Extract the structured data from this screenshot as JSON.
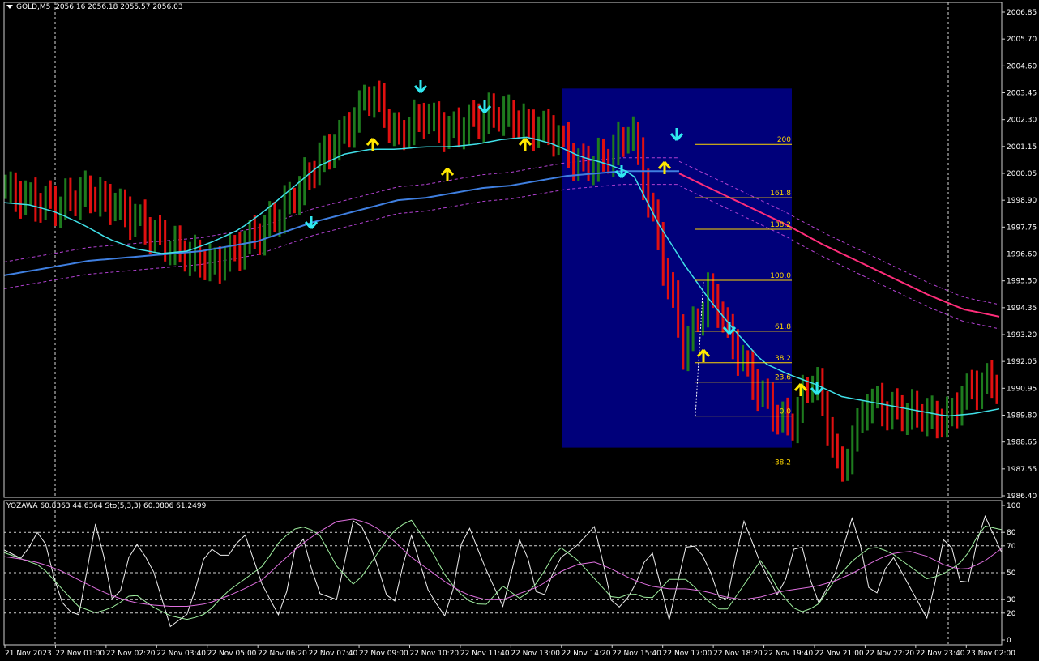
{
  "header": {
    "symbol": "GOLD,M5",
    "ohlc": "2056.16 2056.18 2055.57 2056.03"
  },
  "sub_header": {
    "text": "YOZAWA 60.8363 44.6364  Sto(5,3,3) 60.0806 61.2499"
  },
  "colors": {
    "background": "#000000",
    "bull": "#1e7b1e",
    "bear": "#e01010",
    "ma_fast": "#40e0e8",
    "ma_slow": "#3f7fe0",
    "ma_long": "#ff2d7a",
    "band": "#b040d0",
    "box": "#00007a",
    "fib": "#ffd700",
    "grid": "#9a9a9a",
    "arrow_up": "#ffe800",
    "arrow_down": "#30e8f0"
  },
  "chart_data": [
    {
      "type": "line",
      "ylim": [
        1986.45,
        2006.85
      ],
      "y_ticks": [
        "2006.85",
        "2005.70",
        "2004.60",
        "2003.45",
        "2002.30",
        "2001.15",
        "2000.05",
        "1998.90",
        "1997.75",
        "1996.60",
        "1995.50",
        "1994.35",
        "1993.20",
        "1992.05",
        "1990.95",
        "1989.80",
        "1988.65",
        "1987.55",
        "1986.40"
      ],
      "x_ticks": [
        "21 Nov 2023",
        "22 Nov 01:00",
        "22 Nov 02:20",
        "22 Nov 03:40",
        "22 Nov 05:00",
        "22 Nov 06:20",
        "22 Nov 07:40",
        "22 Nov 09:00",
        "22 Nov 10:20",
        "22 Nov 11:40",
        "22 Nov 13:00",
        "22 Nov 14:20",
        "22 Nov 15:40",
        "22 Nov 17:00",
        "22 Nov 18:20",
        "22 Nov 19:40",
        "22 Nov 21:00",
        "22 Nov 22:20",
        "22 Nov 23:40",
        "23 Nov 02:00"
      ],
      "x": [
        0,
        2,
        4,
        6,
        8,
        10,
        12,
        14,
        16,
        18,
        20,
        22,
        24,
        26,
        28,
        30,
        32,
        34,
        36,
        38
      ],
      "price": [
        1999.1,
        1998.7,
        1998.5,
        1999.0,
        1998.6,
        1997.9,
        1997.0,
        1996.4,
        1996.0,
        1996.8,
        1997.6,
        1998.8,
        2000.3,
        2001.5,
        2003.2,
        2001.3,
        2002.2,
        2001.5,
        2002.0,
        2002.3,
        2001.7,
        2001.5,
        2000.1,
        2000.4,
        2001.6,
        1997.1,
        1992.5,
        1995.0,
        1992.5,
        1990.6,
        1989.3,
        1991.5,
        1987.4,
        1990.4,
        1990.0,
        1989.9,
        1989.6,
        1991.0,
        1991.2
      ],
      "series": [
        {
          "values": [
            1998.6,
            1998.5,
            1998.2,
            1997.7,
            1997.1,
            1996.7,
            1996.5,
            1996.6,
            1997.0,
            1997.5,
            1998.3,
            1999.2,
            2000.1,
            2000.6,
            2000.8,
            2000.8,
            2000.9,
            2000.9,
            2001.0,
            2001.2,
            2001.3,
            2001.0,
            2000.5,
            2000.2,
            1999.8,
            1997.7,
            1996.0,
            1994.5,
            1993.2,
            1992.0,
            1991.5,
            1991.1,
            1990.6,
            1990.4,
            1990.2,
            1990.0,
            1989.8,
            1989.9,
            1990.1
          ]
        },
        {
          "values": [
            1995.6,
            1995.8,
            1996.0,
            1996.2,
            1996.3,
            1996.4,
            1996.5,
            1996.6,
            1996.8,
            1997.0,
            1997.4,
            1997.8,
            1998.1,
            1998.4,
            1998.7,
            1998.8,
            1999.0,
            1999.2,
            1999.3,
            1999.5,
            1999.7,
            1999.8,
            1999.9,
            1999.9,
            1999.9
          ]
        },
        {
          "values": [
            1999.8,
            1999.1,
            1998.4,
            1997.7,
            1996.9,
            1996.2,
            1995.5,
            1994.8,
            1994.2,
            1993.9
          ]
        }
      ]
    },
    {
      "type": "line",
      "ylim": [
        0,
        100
      ],
      "y_ticks": [
        "100",
        "80",
        "70",
        "50",
        "30",
        "20",
        "0"
      ],
      "levels": [
        80,
        70,
        50,
        30,
        20
      ],
      "series": [
        {
          "values": [
            67,
            60,
            85,
            30,
            15,
            90,
            20,
            75,
            55,
            10,
            20,
            70,
            60,
            80,
            40,
            15,
            85,
            35,
            30,
            95,
            65,
            20,
            80,
            35,
            15,
            90,
            55,
            25,
            80,
            25,
            60,
            70,
            85,
            20,
            35,
            70,
            15,
            75,
            60,
            20,
            90,
            55,
            30,
            80,
            25,
            50,
            95,
            25,
            65,
            40,
            15,
            85,
            30,
            95,
            65
          ]
        },
        {
          "values": [
            65,
            60,
            55,
            40,
            25,
            20,
            25,
            35,
            25,
            18,
            15,
            20,
            35,
            45,
            55,
            75,
            85,
            80,
            55,
            40,
            60,
            80,
            90,
            70,
            45,
            30,
            25,
            40,
            30,
            45,
            70,
            60,
            45,
            30,
            35,
            30,
            45,
            45,
            30,
            20,
            40,
            60,
            35,
            20,
            25,
            45,
            60,
            70,
            65,
            55,
            45,
            50,
            60,
            85,
            82
          ]
        },
        {
          "values": [
            62,
            60,
            57,
            52,
            45,
            38,
            32,
            28,
            26,
            25,
            25,
            27,
            32,
            38,
            45,
            58,
            70,
            80,
            88,
            90,
            85,
            75,
            62,
            52,
            42,
            34,
            30,
            30,
            35,
            40,
            50,
            56,
            58,
            52,
            45,
            40,
            38,
            38,
            36,
            32,
            30,
            32,
            36,
            38,
            40,
            44,
            50,
            58,
            64,
            66,
            62,
            55,
            52,
            58,
            68
          ]
        }
      ]
    }
  ],
  "fib": {
    "levels": [
      "200",
      "161.8",
      "138.2",
      "100.0",
      "61.8",
      "38.2",
      "23.6",
      "0.0",
      "-38.2"
    ],
    "prices": [
      2001.0,
      1998.8,
      1997.5,
      1995.4,
      1993.3,
      1992.0,
      1991.2,
      1989.8,
      1987.7
    ]
  }
}
